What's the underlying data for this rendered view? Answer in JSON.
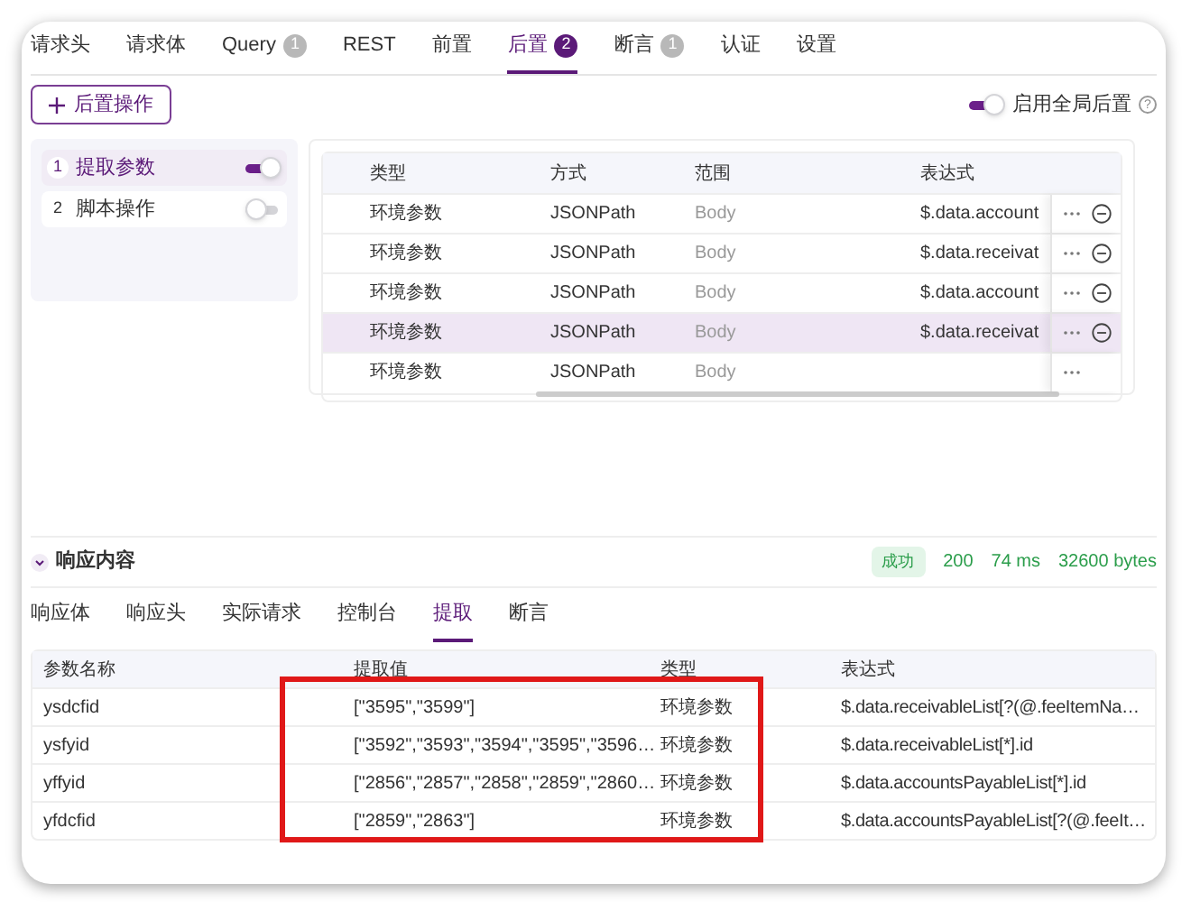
{
  "request_tabs": [
    {
      "label": "请求头",
      "selected": false
    },
    {
      "label": "请求体",
      "selected": false
    },
    {
      "label": "Query",
      "badge": "1",
      "selected": false
    },
    {
      "label": "REST",
      "selected": false
    },
    {
      "label": "前置",
      "selected": false
    },
    {
      "label": "后置",
      "badge": "2",
      "selected": true
    },
    {
      "label": "断言",
      "badge": "1",
      "selected": false
    },
    {
      "label": "认证",
      "selected": false
    },
    {
      "label": "设置",
      "selected": false
    }
  ],
  "add_button": {
    "label": "后置操作"
  },
  "global_toggle": {
    "label": "启用全局后置",
    "on": true,
    "help": "?"
  },
  "steps": [
    {
      "index": "1",
      "label": "提取参数",
      "selected": true,
      "on": true
    },
    {
      "index": "2",
      "label": "脚本操作",
      "selected": false,
      "on": false
    }
  ],
  "post_table": {
    "columns": [
      "类型",
      "方式",
      "范围",
      "表达式"
    ],
    "rows": [
      {
        "type": "环境参数",
        "method": "JSONPath",
        "scope": "Body",
        "expression": "$.data.account",
        "highlighted": false,
        "removable": true
      },
      {
        "type": "环境参数",
        "method": "JSONPath",
        "scope": "Body",
        "expression": "$.data.receivat",
        "highlighted": false,
        "removable": true
      },
      {
        "type": "环境参数",
        "method": "JSONPath",
        "scope": "Body",
        "expression": "$.data.account",
        "highlighted": false,
        "removable": true
      },
      {
        "type": "环境参数",
        "method": "JSONPath",
        "scope": "Body",
        "expression": "$.data.receivat",
        "highlighted": true,
        "removable": true
      },
      {
        "type": "环境参数",
        "method": "JSONPath",
        "scope": "Body",
        "highlighted": false,
        "removable": false
      }
    ]
  },
  "response": {
    "title": "响应内容",
    "expanded": true,
    "status": "成功",
    "code": "200",
    "time": "74 ms",
    "size": "32600 bytes"
  },
  "response_tabs": [
    {
      "label": "响应体",
      "selected": false
    },
    {
      "label": "响应头",
      "selected": false
    },
    {
      "label": "实际请求",
      "selected": false
    },
    {
      "label": "控制台",
      "selected": false
    },
    {
      "label": "提取",
      "selected": true
    },
    {
      "label": "断言",
      "selected": false
    }
  ],
  "extract_table": {
    "columns": [
      "参数名称",
      "提取值",
      "类型",
      "表达式"
    ],
    "rows": [
      {
        "name": "ysdcfid",
        "value": "[\"3595\",\"3599\"]",
        "type": "环境参数",
        "expression": "$.data.receivableList[?(@.feeItemNa…"
      },
      {
        "name": "ysfyid",
        "value": "[\"3592\",\"3593\",\"3594\",\"3595\",\"3596…",
        "type": "环境参数",
        "expression": "$.data.receivableList[*].id"
      },
      {
        "name": "yffyid",
        "value": "[\"2856\",\"2857\",\"2858\",\"2859\",\"2860…",
        "type": "环境参数",
        "expression": "$.data.accountsPayableList[*].id"
      },
      {
        "name": "yfdcfid",
        "value": "[\"2859\",\"2863\"]",
        "type": "环境参数",
        "expression": "$.data.accountsPayableList[?(@.feeIt…"
      }
    ]
  }
}
